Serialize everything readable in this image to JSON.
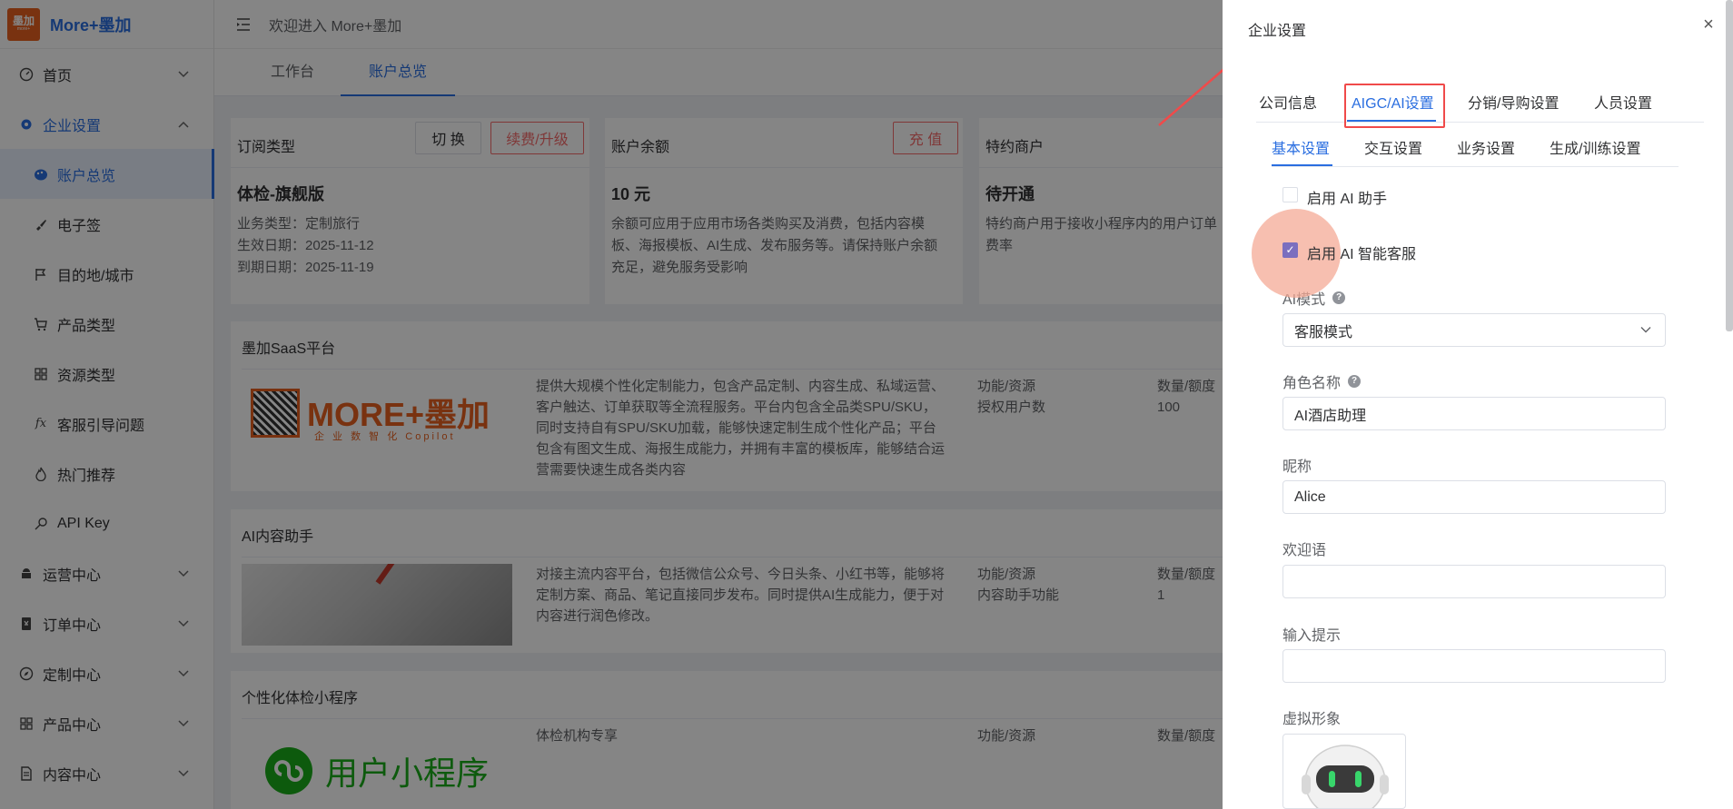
{
  "app": {
    "logo_top": "墨加",
    "logo_sub": "more+",
    "name": "More+墨加",
    "welcome": "欢迎进入 More+墨加"
  },
  "sidebar": {
    "items": [
      {
        "label": "首页",
        "icon": "dashboard-icon",
        "chevron": true
      },
      {
        "label": "企业设置",
        "icon": "gear-icon",
        "chevron": true,
        "open": true
      },
      {
        "label": "账户总览",
        "icon": "palette-icon",
        "sub": true,
        "active": true
      },
      {
        "label": "电子签",
        "icon": "brush-icon",
        "sub": true
      },
      {
        "label": "目的地/城市",
        "icon": "flag-icon",
        "sub": true
      },
      {
        "label": "产品类型",
        "icon": "cart-icon",
        "sub": true
      },
      {
        "label": "资源类型",
        "icon": "grid-icon",
        "sub": true
      },
      {
        "label": "客服引导问题",
        "icon": "fx-icon",
        "sub": true
      },
      {
        "label": "热门推荐",
        "icon": "fire-icon",
        "sub": true
      },
      {
        "label": "API Key",
        "icon": "key-icon",
        "sub": true
      },
      {
        "label": "运营中心",
        "icon": "android-icon",
        "chevron": true
      },
      {
        "label": "订单中心",
        "icon": "cash-icon",
        "chevron": true
      },
      {
        "label": "定制中心",
        "icon": "compass-icon",
        "chevron": true
      },
      {
        "label": "产品中心",
        "icon": "grid-icon",
        "chevron": true
      },
      {
        "label": "内容中心",
        "icon": "document-icon",
        "chevron": true
      }
    ]
  },
  "page_tabs": [
    {
      "label": "工作台"
    },
    {
      "label": "账户总览"
    }
  ],
  "cards": {
    "subscription": {
      "title": "订阅类型",
      "switch_label": "切 换",
      "renew_label": "续费/升级",
      "plan": "体检-旗舰版",
      "lines": [
        "业务类型：定制旅行",
        "生效日期：2025-11-12",
        "到期日期：2025-11-19"
      ]
    },
    "balance": {
      "title": "账户余额",
      "recharge_label": "充 值",
      "amount": "10 元",
      "desc": [
        "余额可应用于应用市场各类购买及消费，包括内容模",
        "板、海报模板、AI生成、发布服务等。请保持账户余额",
        "充足，避免服务受影响"
      ]
    },
    "merchant": {
      "title": "特约商户",
      "status": "待开通",
      "desc": [
        "特约商户用于接收小程序内的用户订单",
        "费率"
      ]
    }
  },
  "sections": [
    {
      "title": "墨加SaaS平台",
      "logo_text": "MORE+墨加",
      "logo_sub": "企 业 数 智 化 Copilot",
      "desc": [
        "提供大规模个性化定制能力，包含产品定制、内容生成、私域运营、",
        "客户触达、订单获取等全流程服务。平台内包含全品类SPU/SKU，",
        "同时支持自有SPU/SKU加载，能够快速定制生成个性化产品；平台",
        "包含有图文生成、海报生成能力，并拥有丰富的模板库，能够结合运",
        "营需要快速生成各类内容"
      ],
      "col1": [
        "功能/资源",
        "授权用户数"
      ],
      "col2": [
        "数量/额度",
        "100"
      ]
    },
    {
      "title": "AI内容助手",
      "desc": [
        "对接主流内容平台，包括微信公众号、今日头条、小红书等，能够将",
        "定制方案、商品、笔记直接同步发布。同时提供AI生成能力，便于对",
        "内容进行润色修改。"
      ],
      "col1": [
        "功能/资源",
        "内容助手功能"
      ],
      "col2": [
        "数量/额度",
        "1"
      ]
    },
    {
      "title": "个性化体检小程序",
      "logo_text": "用户小程序",
      "desc": [
        "体检机构专享"
      ],
      "col1": [
        "功能/资源"
      ],
      "col2": [
        "数量/额度"
      ]
    }
  ],
  "drawer": {
    "title": "企业设置",
    "close": "×",
    "tabs": [
      {
        "label": "公司信息"
      },
      {
        "label": "AIGC/AI设置"
      },
      {
        "label": "分销/导购设置"
      },
      {
        "label": "人员设置"
      }
    ],
    "subtabs": [
      {
        "label": "基本设置"
      },
      {
        "label": "交互设置"
      },
      {
        "label": "业务设置"
      },
      {
        "label": "生成/训练设置"
      }
    ],
    "checkboxes": [
      {
        "label": "启用 AI 助手",
        "checked": false
      },
      {
        "label": "启用 AI 智能客服",
        "checked": true
      }
    ],
    "fields": {
      "ai_mode": {
        "label": "AI模式",
        "value": "客服模式"
      },
      "role_name": {
        "label": "角色名称",
        "value": "AI酒店助理"
      },
      "nickname": {
        "label": "昵称",
        "value": "Alice"
      },
      "welcome": {
        "label": "欢迎语",
        "value": ""
      },
      "input_hint": {
        "label": "输入提示",
        "value": ""
      },
      "avatar": {
        "label": "虚拟形象"
      }
    }
  },
  "colors": {
    "accent": "#2a6ee0",
    "danger": "#f56c6c",
    "highlight": "#f04a4a",
    "checkbox": "#7b6fbf"
  }
}
